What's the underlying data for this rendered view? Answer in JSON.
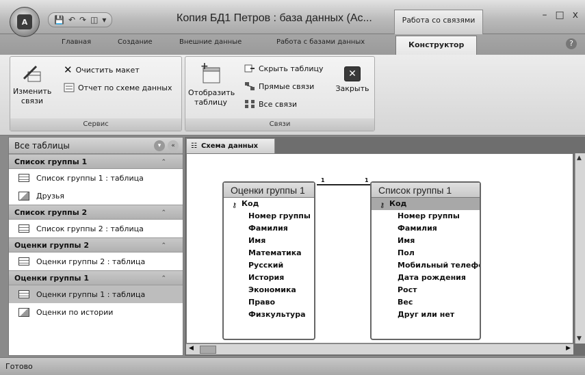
{
  "window": {
    "title": "Копия БД1 Петров : база данных (Ас...",
    "context_tab": "Работа со связями",
    "office_logo": "A",
    "controls": [
      "–",
      "□",
      "x"
    ]
  },
  "qat": {
    "icons": [
      "save-icon",
      "undo-icon",
      "redo-icon",
      "dropdown-icon"
    ]
  },
  "tabs": [
    {
      "label": "Главная"
    },
    {
      "label": "Создание"
    },
    {
      "label": "Внешние данные"
    },
    {
      "label": "Работа с базами данных"
    },
    {
      "label": "Конструктор",
      "active": true
    }
  ],
  "ribbon": {
    "service": {
      "label": "Сервис",
      "edit_links": "Изменить связи",
      "edit_links_line1": "Изменить",
      "edit_links_line2": "связи",
      "clear_layout": "Очистить макет",
      "report": "Отчет по схеме данных"
    },
    "links": {
      "label": "Связи",
      "show_table_line1": "Отобразить",
      "show_table_line2": "таблицу",
      "hide_table": "Скрыть таблицу",
      "direct_links": "Прямые связи",
      "all_links": "Все связи",
      "close": "Закрыть"
    }
  },
  "nav": {
    "header": "Все таблицы",
    "groups": [
      {
        "title": "Список группы 1",
        "items": [
          "Список группы 1 : таблица",
          "Друзья"
        ]
      },
      {
        "title": "Список группы 2",
        "items": [
          "Список группы 2 : таблица"
        ]
      },
      {
        "title": "Оценки группы 2",
        "items": [
          "Оценки группы 2 : таблица"
        ]
      },
      {
        "title": "Оценки группы 1",
        "items": [
          "Оценки группы 1 : таблица",
          "Оценки по истории"
        ]
      }
    ]
  },
  "doc_tab": "Схема данных",
  "schema": {
    "table_left": {
      "title": "Оценки группы 1",
      "fields": [
        "Код",
        "Номер группы",
        "Фамилия",
        "Имя",
        "Математика",
        "Русский",
        "История",
        "Экономика",
        "Право",
        "Физкультура"
      ]
    },
    "table_right": {
      "title": "Список группы 1",
      "fields": [
        "Код",
        "Номер группы",
        "Фамилия",
        "Имя",
        "Пол",
        "Мобильный телефон",
        "Дата рождения",
        "Рост",
        "Вес",
        "Друг или нет"
      ]
    },
    "relation": {
      "left_mark": "1",
      "right_mark": "1"
    }
  },
  "status": "Готово"
}
